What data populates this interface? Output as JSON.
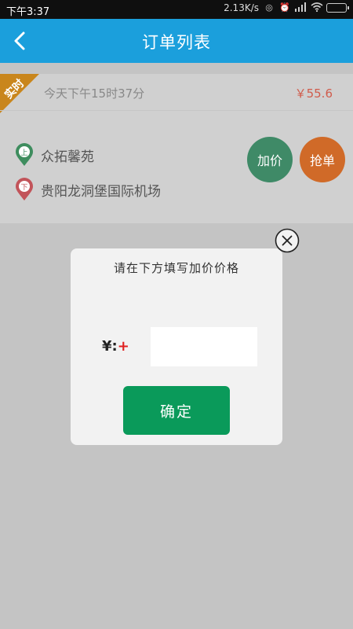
{
  "status_bar": {
    "time": "下午3:37",
    "network_speed": "2.13K/s",
    "icons": [
      "sync-icon",
      "alarm-icon",
      "signal-icon",
      "wifi-icon",
      "battery-icon"
    ]
  },
  "nav": {
    "title": "订单列表",
    "back_icon": "chevron-left-icon",
    "color": "#1b9fdc"
  },
  "order": {
    "badge": "实时",
    "time": "今天下午15时37分",
    "price": "￥55.6",
    "from_marker": "上",
    "from": "众拓馨苑",
    "to_marker": "下",
    "to": "贵阳龙洞堡国际机场",
    "add_price_label": "加价",
    "grab_label": "抢单"
  },
  "dialog": {
    "title": "请在下方填写加价价格",
    "currency_label": "¥:",
    "required_mark": "+",
    "input_value": "",
    "confirm_label": "确定",
    "close_icon": "close-circle-icon"
  }
}
